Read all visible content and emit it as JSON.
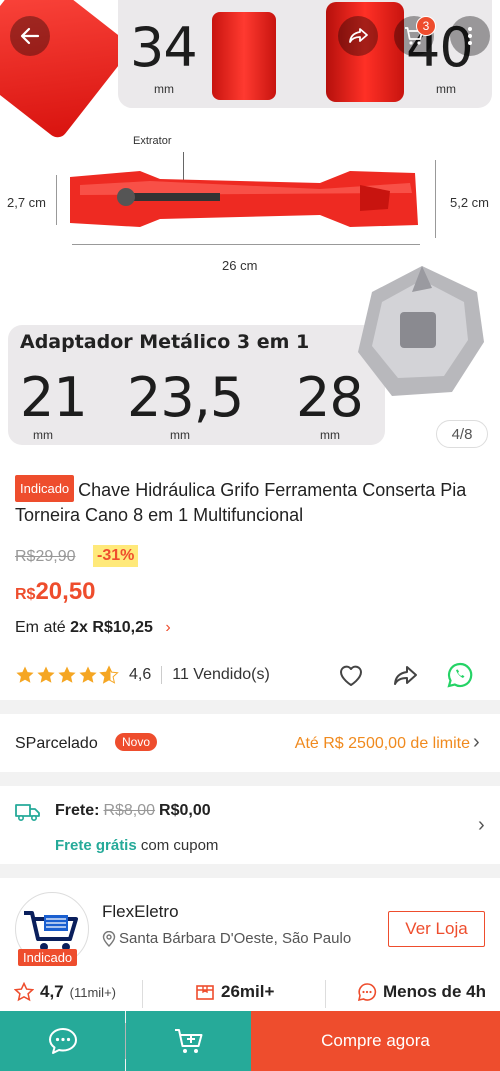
{
  "gallery": {
    "top_sizes": [
      {
        "value": "34",
        "unit": "mm"
      },
      {
        "value": "40",
        "unit": "mm"
      }
    ],
    "extractor_label": "Extrator",
    "width_left": "2,7 cm",
    "width_right": "5,2 cm",
    "length": "26 cm",
    "adapter_title": "Adaptador Metálico 3 em 1",
    "adapter_sizes": [
      {
        "value": "21",
        "unit": "mm"
      },
      {
        "value": "23,5",
        "unit": "mm"
      },
      {
        "value": "28",
        "unit": "mm"
      }
    ],
    "page_indicator": "4/8",
    "cart_count": "3"
  },
  "product": {
    "badge": "Indicado",
    "title": "Chave Hidráulica Grifo Ferramenta Conserta Pia Torneira Cano 8 em 1 Multifuncional",
    "old_price": "R$29,90",
    "discount": "-31%",
    "price_currency": "R$",
    "price_value": "20,50",
    "installment_prefix": "Em até",
    "installment_value": "2x R$10,25",
    "rating": "4,6",
    "rating_fraction": 0.92,
    "sold": "11 Vendido(s)"
  },
  "sparcelado": {
    "label": "SParcelado",
    "badge": "Novo",
    "limit": "Até R$ 2500,00 de limite"
  },
  "shipping": {
    "label": "Frete:",
    "old": "R$8,00",
    "new": "R$0,00",
    "free_label": "Frete grátis",
    "free_suffix": "com cupom"
  },
  "store": {
    "name": "FlexEletro",
    "location": "Santa Bárbara D'Oeste, São Paulo",
    "badge": "Indicado",
    "button": "Ver Loja",
    "rating": "4,7",
    "rating_count": "(11mil+)",
    "products": "26mil+",
    "response": "Menos de 4h"
  },
  "bottom": {
    "buy": "Compre agora"
  },
  "colors": {
    "accent": "#ee4d2d",
    "teal": "#26aa99",
    "orange": "#f08a1e"
  }
}
